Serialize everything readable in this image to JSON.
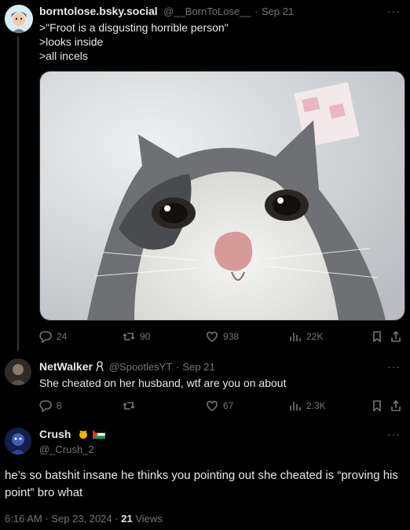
{
  "tweet1": {
    "display_name": "borntolose.bsky.social",
    "handle": "@__BornToLose__",
    "separator": "·",
    "date": "Sep 21",
    "more": "···",
    "lines": [
      ">\"Froot is a disgusting horrible person\"",
      ">looks inside",
      ">all incels"
    ],
    "replies": "24",
    "reposts": "90",
    "likes": "938",
    "views": "22K"
  },
  "tweet2": {
    "display_name": "NetWalker",
    "handle": "@SpootlesYT",
    "separator": "·",
    "date": "Sep 21",
    "more": "···",
    "text": "She cheated on her husband, wtf are you on about",
    "replies": "8",
    "reposts": "",
    "likes": "67",
    "views": "2.3K"
  },
  "tweet3": {
    "display_name": "Crush",
    "handle": "@_Crush_2",
    "more": "···",
    "text": "he’s so batshit insane he thinks you pointing out she cheated is “proving his point” bro what",
    "time": "6:16 AM",
    "separator": "·",
    "date": "Sep 23, 2024",
    "views_count": "21",
    "views_label": "Views"
  },
  "colors": {
    "background": "#000000",
    "text": "#e7e9ea",
    "muted": "#71767b",
    "divider": "#2f3336"
  }
}
